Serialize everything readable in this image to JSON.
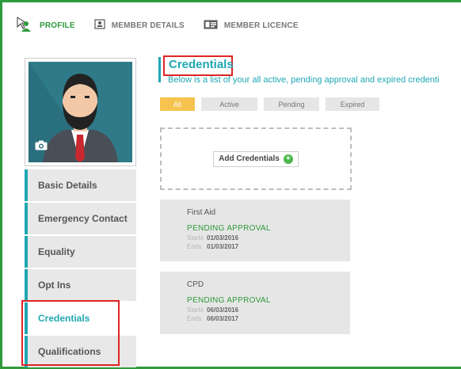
{
  "nav": {
    "items": [
      {
        "label": "PROFILE",
        "icon": "person-icon",
        "active": true
      },
      {
        "label": "MEMBER DETAILS",
        "icon": "id-card-icon",
        "active": false
      },
      {
        "label": "MEMBER LICENCE",
        "icon": "licence-card-icon",
        "active": false
      }
    ]
  },
  "sidebar": {
    "items": [
      {
        "label": "Basic Details"
      },
      {
        "label": "Emergency Contact"
      },
      {
        "label": "Equality"
      },
      {
        "label": "Opt Ins"
      },
      {
        "label": "Credentials",
        "active": true
      },
      {
        "label": "Qualifications"
      }
    ]
  },
  "main": {
    "title": "Credentials",
    "subtitle": "Below is a list of your all active, pending approval and expired credenti",
    "filters": [
      {
        "label": "All",
        "active": true
      },
      {
        "label": "Active"
      },
      {
        "label": "Pending"
      },
      {
        "label": "Expired"
      }
    ],
    "add_label": "Add Credentials",
    "cards": [
      {
        "name": "First Aid",
        "status": "PENDING APPROVAL",
        "starts_label": "Starts",
        "starts": "01/03/2016",
        "ends_label": "Ends",
        "ends": "01/03/2017"
      },
      {
        "name": "CPD",
        "status": "PENDING APPROVAL",
        "starts_label": "Starts",
        "starts": "06/03/2016",
        "ends_label": "Ends",
        "ends": "06/03/2017"
      }
    ]
  },
  "colors": {
    "brand_green": "#2e9a3c",
    "accent_teal": "#1fa7b3",
    "filter_active": "#f6c34f",
    "highlight_red": "#e02424"
  }
}
